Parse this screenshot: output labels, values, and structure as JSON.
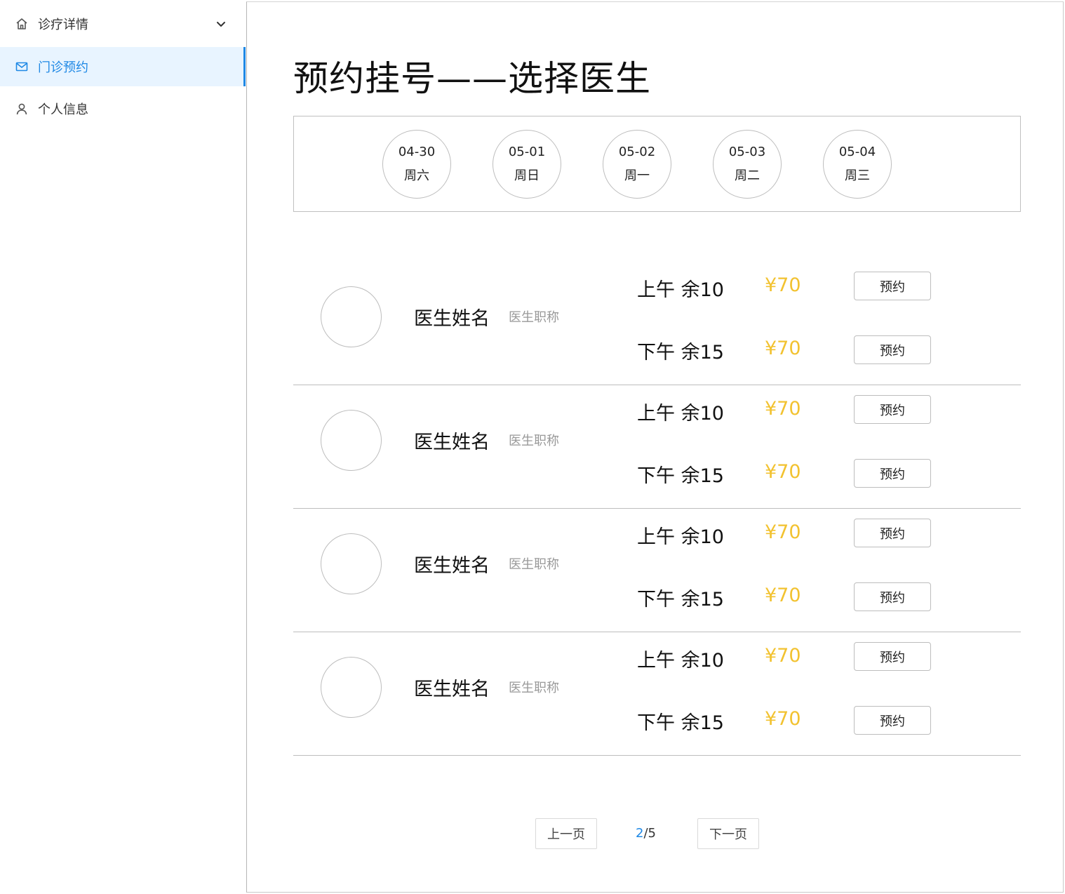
{
  "sidebar": {
    "items": [
      {
        "label": "诊疗详情",
        "icon": "home-icon",
        "has_dropdown": true,
        "active": false
      },
      {
        "label": "门诊预约",
        "icon": "mail-icon",
        "has_dropdown": false,
        "active": true
      },
      {
        "label": "个人信息",
        "icon": "user-icon",
        "has_dropdown": false,
        "active": false
      }
    ]
  },
  "main": {
    "title": "预约挂号——选择医生",
    "dates": [
      {
        "date": "04-30",
        "weekday": "周六"
      },
      {
        "date": "05-01",
        "weekday": "周日"
      },
      {
        "date": "05-02",
        "weekday": "周一"
      },
      {
        "date": "05-03",
        "weekday": "周二"
      },
      {
        "date": "05-04",
        "weekday": "周三"
      }
    ],
    "doctors": [
      {
        "name": "医生姓名",
        "title": "医生职称",
        "slots": [
          {
            "label": "上午 余10",
            "price": "¥70",
            "button": "预约"
          },
          {
            "label": "下午 余15",
            "price": "¥70",
            "button": "预约"
          }
        ]
      },
      {
        "name": "医生姓名",
        "title": "医生职称",
        "slots": [
          {
            "label": "上午 余10",
            "price": "¥70",
            "button": "预约"
          },
          {
            "label": "下午 余15",
            "price": "¥70",
            "button": "预约"
          }
        ]
      },
      {
        "name": "医生姓名",
        "title": "医生职称",
        "slots": [
          {
            "label": "上午 余10",
            "price": "¥70",
            "button": "预约"
          },
          {
            "label": "下午 余15",
            "price": "¥70",
            "button": "预约"
          }
        ]
      },
      {
        "name": "医生姓名",
        "title": "医生职称",
        "slots": [
          {
            "label": "上午 余10",
            "price": "¥70",
            "button": "预约"
          },
          {
            "label": "下午 余15",
            "price": "¥70",
            "button": "预约"
          }
        ]
      }
    ]
  },
  "pagination": {
    "prev_label": "上一页",
    "next_label": "下一页",
    "current": "2",
    "separator": "/",
    "total": "5"
  },
  "colors": {
    "accent": "#1e88e5",
    "active_bg": "#e8f4ff",
    "price": "#f2c230",
    "border": "#bdbdbd"
  }
}
